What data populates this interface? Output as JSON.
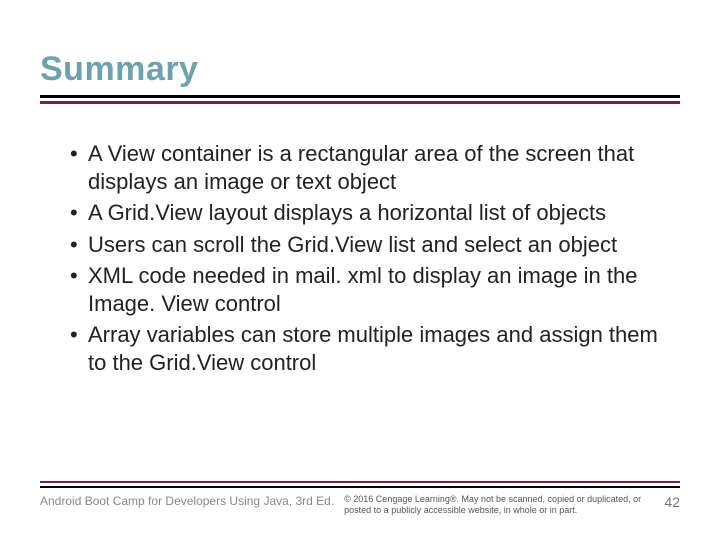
{
  "title": "Summary",
  "bullets": [
    "A View container is a rectangular area of the screen that displays an image or text object",
    "A Grid.View layout displays a horizontal list of objects",
    "Users can scroll the Grid.View list and select an object",
    "XML code needed in mail. xml to display an image in the Image. View control",
    "Array variables can store multiple images and assign them to the Grid.View control"
  ],
  "footer": {
    "left": "Android Boot Camp for Developers Using Java, 3rd Ed.",
    "center": "© 2016 Cengage Learning®. May not be scanned, copied or duplicated, or posted to a publicly accessible website, in whole or in part.",
    "page": "42"
  }
}
